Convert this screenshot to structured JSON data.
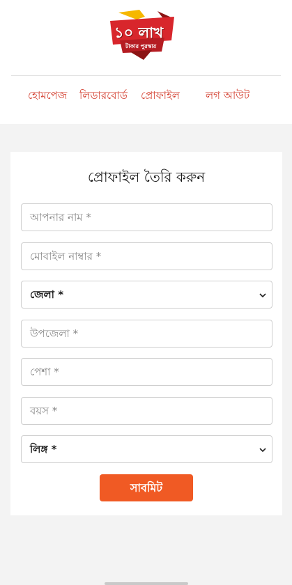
{
  "logo": {
    "main_text": "১০ লাখ",
    "sub_text": "টাকার পুরস্কার",
    "colors": {
      "red": "#d8262c",
      "dark_red": "#8c1414",
      "yellow": "#f6b800"
    }
  },
  "nav": {
    "items": [
      {
        "label": "হোমপেজ"
      },
      {
        "label": "লিডারবোর্ড"
      },
      {
        "label": "প্রোফাইল"
      },
      {
        "label": "লগ আউট"
      }
    ],
    "color": "#d23a2a"
  },
  "form": {
    "title": "প্রোফাইল তৈরি করুন",
    "name_placeholder": "আপনার নাম *",
    "mobile_placeholder": "মোবাইল নাম্বার *",
    "district_selected": "জেলা *",
    "upazila_placeholder": "উপজেলা *",
    "occupation_placeholder": "পেশা *",
    "age_placeholder": "বয়স *",
    "gender_selected": "লিঙ্গ *",
    "submit_label": "সাবমিট",
    "submit_color": "#f05a24"
  }
}
